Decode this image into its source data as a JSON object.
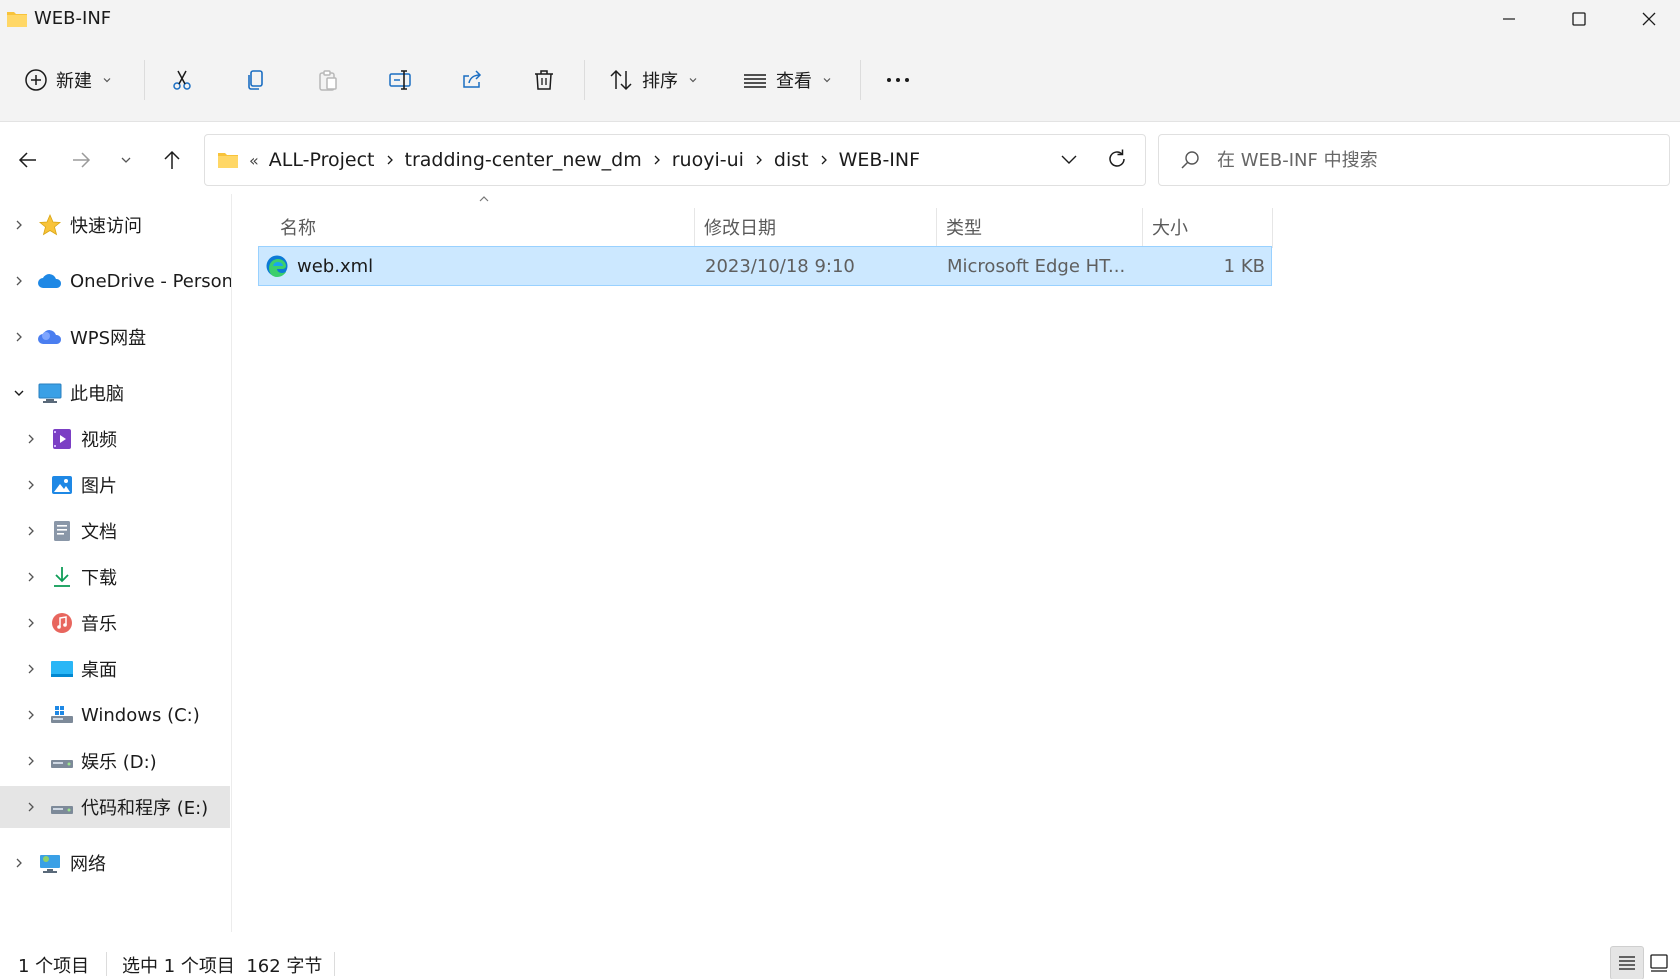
{
  "window": {
    "title": "WEB-INF"
  },
  "toolbar": {
    "new_label": "新建",
    "sort_label": "排序",
    "view_label": "查看"
  },
  "address": {
    "overflow": "«",
    "crumbs": [
      "ALL-Project",
      "tradding-center_new_dm",
      "ruoyi-ui",
      "dist",
      "WEB-INF"
    ]
  },
  "search": {
    "placeholder": "在 WEB-INF 中搜索"
  },
  "sidebar": {
    "items": [
      {
        "label": "快速访问"
      },
      {
        "label": "OneDrive - Personal"
      },
      {
        "label": "WPS网盘"
      },
      {
        "label": "此电脑"
      },
      {
        "label": "视频"
      },
      {
        "label": "图片"
      },
      {
        "label": "文档"
      },
      {
        "label": "下载"
      },
      {
        "label": "音乐"
      },
      {
        "label": "桌面"
      },
      {
        "label": "Windows (C:)"
      },
      {
        "label": "娱乐 (D:)"
      },
      {
        "label": "代码和程序 (E:)"
      },
      {
        "label": "网络"
      }
    ]
  },
  "columns": {
    "name": "名称",
    "modified": "修改日期",
    "type": "类型",
    "size": "大小"
  },
  "files": [
    {
      "name": "web.xml",
      "modified": "2023/10/18 9:10",
      "type": "Microsoft Edge HT...",
      "size": "1 KB"
    }
  ],
  "status": {
    "count": "1 个项目",
    "selected": "选中 1 个项目  162 字节"
  },
  "colors": {
    "accent": "#0067c0",
    "selection": "#cce8ff",
    "folder": "#f8c33a"
  }
}
